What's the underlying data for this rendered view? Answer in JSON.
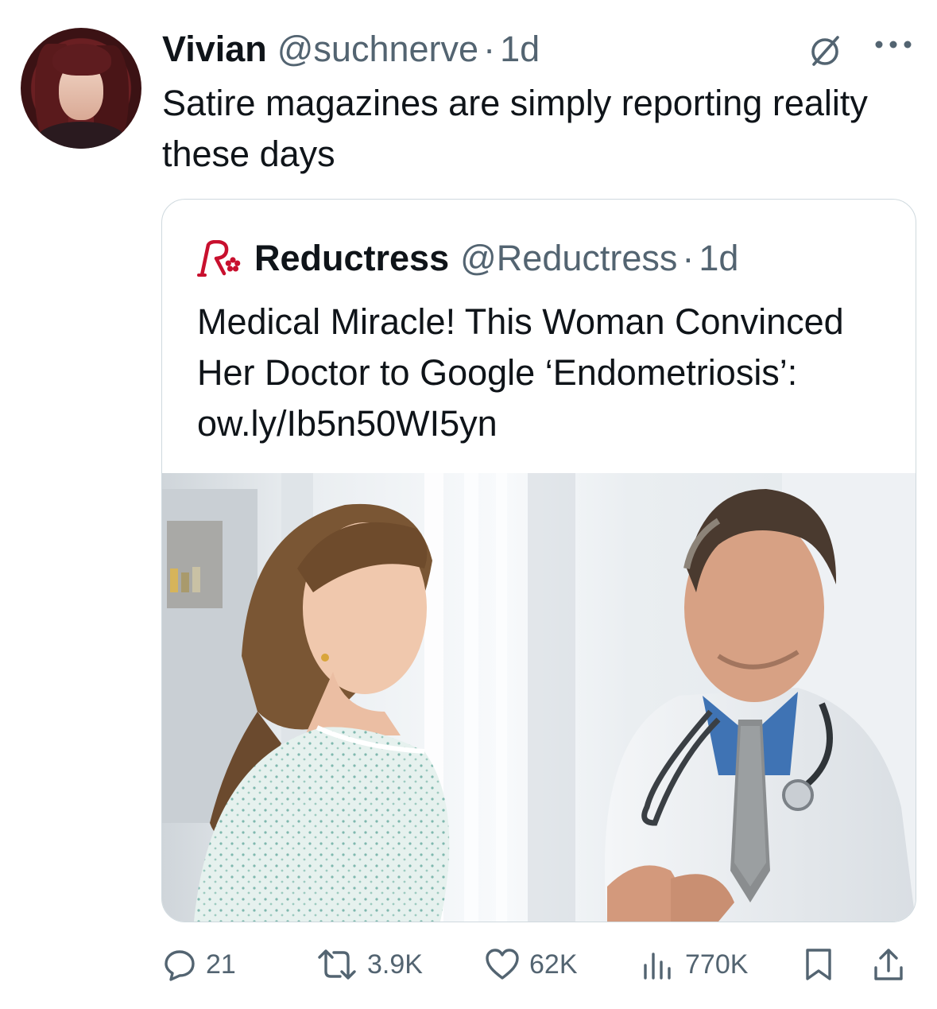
{
  "tweet": {
    "display_name": "Vivian",
    "handle": "@suchnerve",
    "separator": "·",
    "time": "1d",
    "text": "Satire magazines are simply reporting reality these days"
  },
  "quoted": {
    "display_name": "Reductress",
    "handle": "@Reductress",
    "separator": "·",
    "time": "1d",
    "text": "Medical Miracle! This Woman Convinced Her Doctor to Google ‘Endometriosis’: ow.ly/Ib5n50WI5yn"
  },
  "actions": {
    "replies": "21",
    "reposts": "3.9K",
    "likes": "62K",
    "views": "770K"
  },
  "icons": {
    "mute": "mute-icon",
    "more": "more-icon",
    "reply": "reply-icon",
    "repost": "repost-icon",
    "like": "heart-icon",
    "views": "views-icon",
    "bookmark": "bookmark-icon",
    "share": "share-icon",
    "logo": "reductress-logo"
  },
  "colors": {
    "text": "#0f1419",
    "muted": "#536471",
    "border": "#cfd9de",
    "logo_red": "#c8102e"
  }
}
